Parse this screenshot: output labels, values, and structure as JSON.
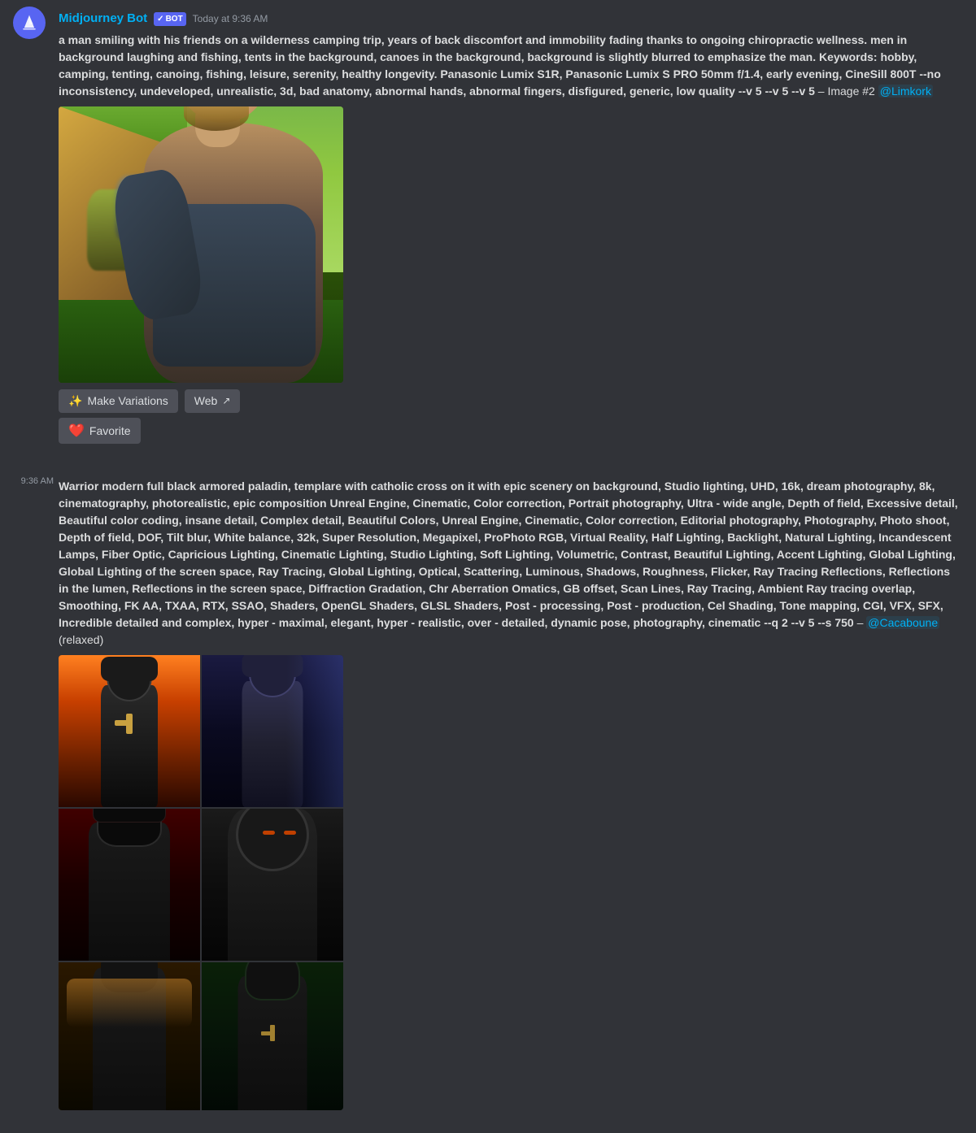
{
  "bot": {
    "name": "Midjourney Bot",
    "badge": "BOT",
    "avatar_icon": "sailboat"
  },
  "messages": [
    {
      "id": "msg1",
      "timestamp_left": "9:36 AM",
      "timestamp_header": "Today at 9:36 AM",
      "content_bold": "a man smiling with his friends on a wilderness camping trip, years of back discomfort and immobility fading thanks to ongoing chiropractic wellness. men in background laughing and fishing, tents in the background, canoes in the background, background is slightly blurred to emphasize the man. Keywords: hobby, camping, tenting, canoing, fishing, leisure, serenity, healthy longevity. Panasonic Lumix S1R, Panasonic Lumix S PRO 50mm f/1.4, early evening, CineSill 800T --no inconsistency, undeveloped, unrealistic, 3d, bad anatomy, abnormal hands, abnormal fingers, disfigured, generic, low quality --v 5 --v 5 --v 5",
      "content_suffix": " – Image #2 ",
      "mention": "@Limkork",
      "image_type": "single",
      "image_alt": "Man smiling with friends on camping trip",
      "buttons": [
        {
          "id": "make-variations",
          "icon": "✨",
          "label": "Make Variations"
        },
        {
          "id": "web",
          "icon": "↗",
          "label": "Web"
        }
      ],
      "extra_buttons": [
        {
          "id": "favorite",
          "icon": "❤️",
          "label": "Favorite"
        }
      ]
    },
    {
      "id": "msg2",
      "timestamp_left": "9:36 AM",
      "content_bold": "Warrior modern full black armored paladin, templare with catholic cross on it with epic scenery on background, Studio lighting, UHD, 16k, dream photography, 8k, cinematography, photorealistic, epic composition Unreal Engine, Cinematic, Color correction, Portrait photography, Ultra - wide angle, Depth of field, Excessive detail, Beautiful color coding, insane detail, Complex detail, Beautiful Colors, Unreal Engine, Cinematic, Color correction, Editorial photography, Photography, Photo shoot, Depth of field, DOF, Tilt blur, White balance, 32k, Super Resolution, Megapixel, ProPhoto RGB, Virtual Reality, Half Lighting, Backlight, Natural Lighting, Incandescent Lamps, Fiber Optic, Capricious Lighting, Cinematic Lighting, Studio Lighting, Soft Lighting, Volumetric, Contrast, Beautiful Lighting, Accent Lighting, Global Lighting, Global Lighting of the screen space, Ray Tracing, Global Lighting, Optical, Scattering, Luminous, Shadows, Roughness, Flicker, Ray Tracing Reflections, Reflections in the lumen, Reflections in the screen space, Diffraction Gradation, Chr Aberration Omatics, GB offset, Scan Lines, Ray Tracing, Ambient Ray tracing overlap, Smoothing, FK AA, TXAA, RTX, SSAO, Shaders, OpenGL Shaders, GLSL Shaders, Post - processing, Post - production, Cel Shading, Tone mapping, CGI, VFX, SFX, Incredible detailed and complex, hyper - maximal, elegant, hyper - realistic, over - detailed, dynamic pose, photography, cinematic --q 2 --v 5 --s 750",
      "content_suffix": " – ",
      "mention": "@Cacaboune",
      "content_end": " (relaxed)",
      "image_type": "quad_tall",
      "image_alt": "Black armored paladin warrior"
    }
  ],
  "action_icons": {
    "clock": "🕐",
    "reply": "↩",
    "hash": "#",
    "ellipsis": "⋯"
  }
}
